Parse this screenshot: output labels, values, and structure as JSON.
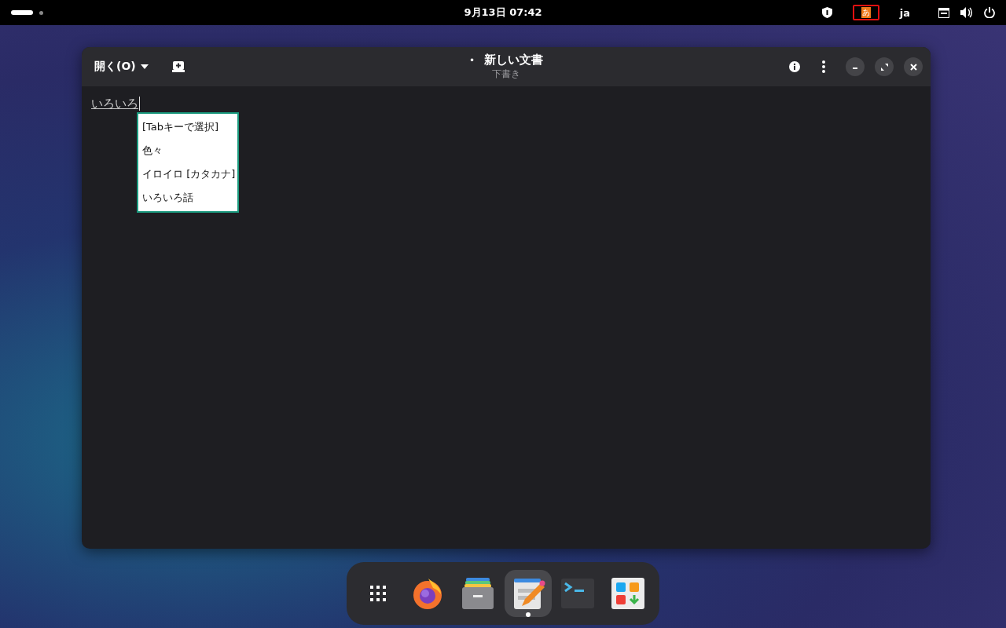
{
  "top_bar": {
    "clock": "9月13日  07:42",
    "input_method": {
      "label": "あ",
      "outlined": true
    },
    "language": "ja"
  },
  "window": {
    "open_button": "開く(O)",
    "title": "新しい文書",
    "modified_mark": "•",
    "subtitle": "下書き"
  },
  "editor": {
    "text": "いろいろ",
    "candidates": [
      {
        "label": "[Tabキーで選択]"
      },
      {
        "label": "色々"
      },
      {
        "label": "イロイロ [カタカナ]"
      },
      {
        "label": "いろいろ話"
      }
    ]
  },
  "dock": [
    {
      "kind": "apps",
      "running": false
    },
    {
      "kind": "browser",
      "running": false
    },
    {
      "kind": "files",
      "running": false
    },
    {
      "kind": "editor",
      "running": true
    },
    {
      "kind": "terminal",
      "running": false
    },
    {
      "kind": "software",
      "running": false
    }
  ]
}
